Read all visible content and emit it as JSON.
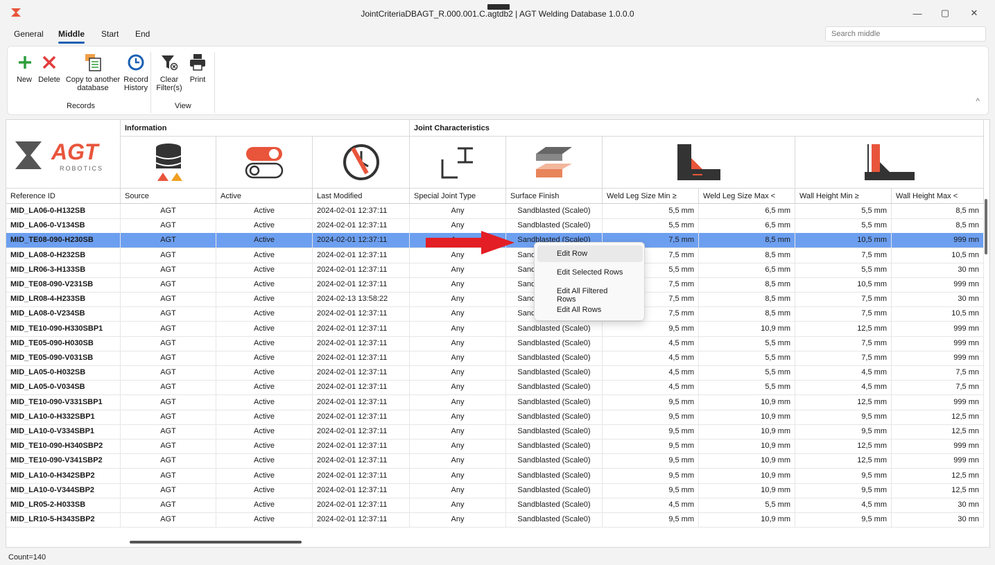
{
  "window": {
    "title": "JointCriteriaDBAGT_R.000.001.C.agtdb2 | AGT Welding Database 1.0.0.0",
    "minimize": "—",
    "maximize": "▢",
    "close": "✕"
  },
  "tabs": [
    {
      "label": "General"
    },
    {
      "label": "Middle"
    },
    {
      "label": "Start"
    },
    {
      "label": "End"
    }
  ],
  "search": {
    "placeholder": "Search middle"
  },
  "ribbon": {
    "buttons": {
      "new": "New",
      "delete": "Delete",
      "copy": "Copy to another database",
      "history": "Record History",
      "clear": "Clear Filter(s)",
      "print": "Print"
    },
    "groups": {
      "records": "Records",
      "view": "View"
    },
    "collapse": "^"
  },
  "grid": {
    "bands": {
      "information": "Information",
      "joint": "Joint Characteristics"
    },
    "logo": {
      "brand": "AGT",
      "sub": "ROBOTICS"
    },
    "columns": [
      "Reference ID",
      "Source",
      "Active",
      "Last Modified",
      "Special Joint Type",
      "Surface Finish",
      "Weld Leg Size Min ≥",
      "Weld Leg Size Max <",
      "Wall Height Min ≥",
      "Wall Height Max <"
    ],
    "rows": [
      [
        "MID_LA06-0-H132SB",
        "AGT",
        "Active",
        "2024-02-01 12:37:11",
        "Any",
        "Sandblasted (Scale0)",
        "5,5 mm",
        "6,5 mm",
        "5,5 mm",
        "8,5 mn"
      ],
      [
        "MID_LA06-0-V134SB",
        "AGT",
        "Active",
        "2024-02-01 12:37:11",
        "Any",
        "Sandblasted (Scale0)",
        "5,5 mm",
        "6,5 mm",
        "5,5 mm",
        "8,5 mn"
      ],
      [
        "MID_TE08-090-H230SB",
        "AGT",
        "Active",
        "2024-02-01 12:37:11",
        "Any",
        "Sandblasted (Scale0)",
        "7,5 mm",
        "8,5 mm",
        "10,5 mm",
        "999 mn"
      ],
      [
        "MID_LA08-0-H232SB",
        "AGT",
        "Active",
        "2024-02-01 12:37:11",
        "Any",
        "Sandblasted (Scale0)",
        "7,5 mm",
        "8,5 mm",
        "7,5 mm",
        "10,5 mn"
      ],
      [
        "MID_LR06-3-H133SB",
        "AGT",
        "Active",
        "2024-02-01 12:37:11",
        "Any",
        "Sandblasted (Scale0)",
        "5,5 mm",
        "6,5 mm",
        "5,5 mm",
        "30 mn"
      ],
      [
        "MID_TE08-090-V231SB",
        "AGT",
        "Active",
        "2024-02-01 12:37:11",
        "Any",
        "Sandblasted (Scale0)",
        "7,5 mm",
        "8,5 mm",
        "10,5 mm",
        "999 mn"
      ],
      [
        "MID_LR08-4-H233SB",
        "AGT",
        "Active",
        "2024-02-13 13:58:22",
        "Any",
        "Sandblasted (Scale0)",
        "7,5 mm",
        "8,5 mm",
        "7,5 mm",
        "30 mn"
      ],
      [
        "MID_LA08-0-V234SB",
        "AGT",
        "Active",
        "2024-02-01 12:37:11",
        "Any",
        "Sandblasted (Scale0)",
        "7,5 mm",
        "8,5 mm",
        "7,5 mm",
        "10,5 mn"
      ],
      [
        "MID_TE10-090-H330SBP1",
        "AGT",
        "Active",
        "2024-02-01 12:37:11",
        "Any",
        "Sandblasted (Scale0)",
        "9,5 mm",
        "10,9 mm",
        "12,5 mm",
        "999 mn"
      ],
      [
        "MID_TE05-090-H030SB",
        "AGT",
        "Active",
        "2024-02-01 12:37:11",
        "Any",
        "Sandblasted (Scale0)",
        "4,5 mm",
        "5,5 mm",
        "7,5 mm",
        "999 mn"
      ],
      [
        "MID_TE05-090-V031SB",
        "AGT",
        "Active",
        "2024-02-01 12:37:11",
        "Any",
        "Sandblasted (Scale0)",
        "4,5 mm",
        "5,5 mm",
        "7,5 mm",
        "999 mn"
      ],
      [
        "MID_LA05-0-H032SB",
        "AGT",
        "Active",
        "2024-02-01 12:37:11",
        "Any",
        "Sandblasted (Scale0)",
        "4,5 mm",
        "5,5 mm",
        "4,5 mm",
        "7,5 mn"
      ],
      [
        "MID_LA05-0-V034SB",
        "AGT",
        "Active",
        "2024-02-01 12:37:11",
        "Any",
        "Sandblasted (Scale0)",
        "4,5 mm",
        "5,5 mm",
        "4,5 mm",
        "7,5 mn"
      ],
      [
        "MID_TE10-090-V331SBP1",
        "AGT",
        "Active",
        "2024-02-01 12:37:11",
        "Any",
        "Sandblasted (Scale0)",
        "9,5 mm",
        "10,9 mm",
        "12,5 mm",
        "999 mn"
      ],
      [
        "MID_LA10-0-H332SBP1",
        "AGT",
        "Active",
        "2024-02-01 12:37:11",
        "Any",
        "Sandblasted (Scale0)",
        "9,5 mm",
        "10,9 mm",
        "9,5 mm",
        "12,5 mn"
      ],
      [
        "MID_LA10-0-V334SBP1",
        "AGT",
        "Active",
        "2024-02-01 12:37:11",
        "Any",
        "Sandblasted (Scale0)",
        "9,5 mm",
        "10,9 mm",
        "9,5 mm",
        "12,5 mn"
      ],
      [
        "MID_TE10-090-H340SBP2",
        "AGT",
        "Active",
        "2024-02-01 12:37:11",
        "Any",
        "Sandblasted (Scale0)",
        "9,5 mm",
        "10,9 mm",
        "12,5 mm",
        "999 mn"
      ],
      [
        "MID_TE10-090-V341SBP2",
        "AGT",
        "Active",
        "2024-02-01 12:37:11",
        "Any",
        "Sandblasted (Scale0)",
        "9,5 mm",
        "10,9 mm",
        "12,5 mm",
        "999 mn"
      ],
      [
        "MID_LA10-0-H342SBP2",
        "AGT",
        "Active",
        "2024-02-01 12:37:11",
        "Any",
        "Sandblasted (Scale0)",
        "9,5 mm",
        "10,9 mm",
        "9,5 mm",
        "12,5 mn"
      ],
      [
        "MID_LA10-0-V344SBP2",
        "AGT",
        "Active",
        "2024-02-01 12:37:11",
        "Any",
        "Sandblasted (Scale0)",
        "9,5 mm",
        "10,9 mm",
        "9,5 mm",
        "12,5 mn"
      ],
      [
        "MID_LR05-2-H033SB",
        "AGT",
        "Active",
        "2024-02-01 12:37:11",
        "Any",
        "Sandblasted (Scale0)",
        "4,5 mm",
        "5,5 mm",
        "4,5 mm",
        "30 mn"
      ],
      [
        "MID_LR10-5-H343SBP2",
        "AGT",
        "Active",
        "2024-02-01 12:37:11",
        "Any",
        "Sandblasted (Scale0)",
        "9,5 mm",
        "10,9 mm",
        "9,5 mm",
        "30 mn"
      ]
    ],
    "selected_row": 2
  },
  "context_menu": [
    {
      "label": "Edit Row"
    },
    {
      "label": "Edit Selected Rows"
    },
    {
      "label": "Edit All Filtered Rows"
    },
    {
      "label": "Edit All Rows"
    }
  ],
  "status": {
    "count": "Count=140"
  },
  "colors": {
    "accent": "#1a5fb4",
    "selection": "#6d9ff0",
    "new_green": "#2e9e3a",
    "delete_red": "#e23b3b",
    "arrow_red": "#e31e24"
  }
}
